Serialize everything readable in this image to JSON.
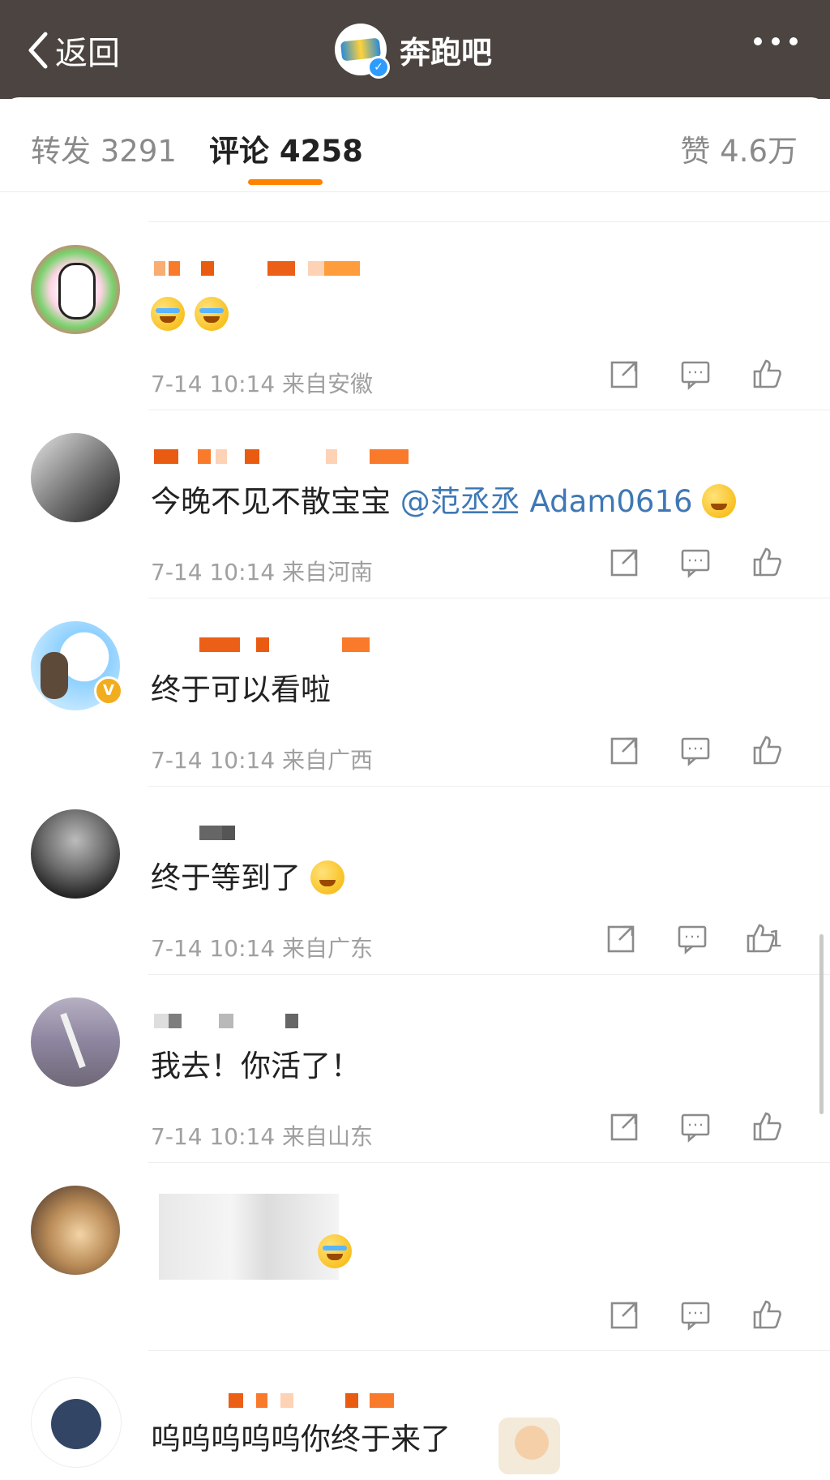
{
  "header": {
    "back_label": "返回",
    "title": "奔跑吧"
  },
  "tabs": {
    "repost": "转发 3291",
    "comments": "评论 4258",
    "likes": "赞 4.6万"
  },
  "comments": [
    {
      "text": "",
      "time": "7-14 10:14",
      "location": "来自安徽",
      "like_count": ""
    },
    {
      "text": "今晚不见不散宝宝",
      "mention": "@范丞丞 Adam0616",
      "time": "7-14 10:14",
      "location": "来自河南",
      "like_count": ""
    },
    {
      "text": "终于可以看啦",
      "time": "7-14 10:14",
      "location": "来自广西",
      "like_count": ""
    },
    {
      "text": "终于等到了",
      "time": "7-14 10:14",
      "location": "来自广东",
      "like_count": "1"
    },
    {
      "text": "我去！你活了！",
      "time": "7-14 10:14",
      "location": "来自山东",
      "like_count": ""
    },
    {
      "text": "",
      "time": "",
      "location": "",
      "like_count": ""
    },
    {
      "text": "呜呜呜呜呜你终于来了",
      "time": "",
      "location": "",
      "like_count": ""
    }
  ]
}
